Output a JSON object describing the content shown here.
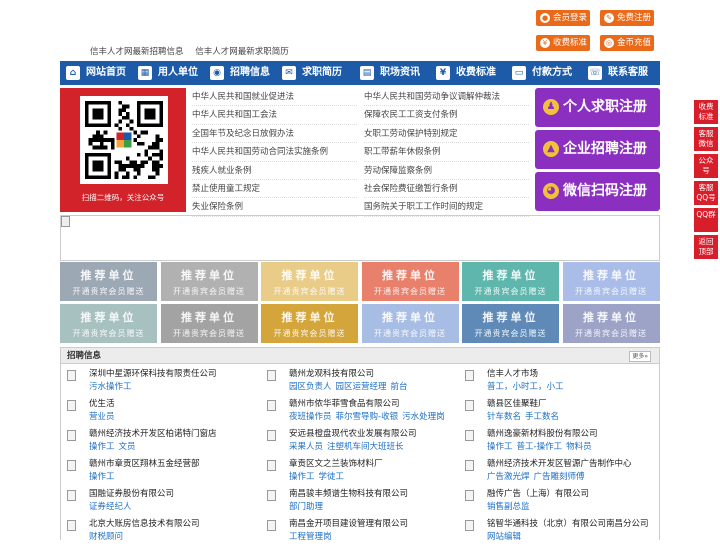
{
  "header": {
    "buttons": [
      {
        "label": "会员登录",
        "icon": "user-icon"
      },
      {
        "label": "免费注册",
        "icon": "register-icon"
      },
      {
        "label": "收费标准",
        "icon": "price-icon"
      },
      {
        "label": "金币充值",
        "icon": "coin-icon"
      }
    ],
    "links": [
      "信丰人才网最新招聘信息",
      "信丰人才网最新求职简历"
    ]
  },
  "nav": {
    "color": "#1d5ba8",
    "items": [
      {
        "label": "网站首页",
        "icon": "home-icon"
      },
      {
        "label": "用人单位",
        "icon": "building-icon"
      },
      {
        "label": "招聘信息",
        "icon": "broadcast-icon"
      },
      {
        "label": "求职简历",
        "icon": "resume-icon"
      },
      {
        "label": "职场资讯",
        "icon": "news-icon"
      },
      {
        "label": "收费标准",
        "icon": "price-icon"
      },
      {
        "label": "付款方式",
        "icon": "payment-icon"
      },
      {
        "label": "联系客服",
        "icon": "phone-icon"
      }
    ]
  },
  "qr": {
    "caption": "扫描二维码，关注公众号"
  },
  "laws": {
    "left": [
      "中华人民共和国就业促进法",
      "中华人民共和国工会法",
      "全国年节及纪念日放假办法",
      "中华人民共和国劳动合同法实施条例",
      "残疾人就业条例",
      "禁止使用童工规定",
      "失业保险条例"
    ],
    "right": [
      "中华人民共和国劳动争议调解仲裁法",
      "保障农民工工资支付条例",
      "女职工劳动保护特别规定",
      "职工带薪年休假条例",
      "劳动保障监察条例",
      "社会保险费征缴暂行条例",
      "国务院关于职工工作时间的规定"
    ]
  },
  "register": [
    {
      "label": "个人求职注册",
      "icon": "person-icon"
    },
    {
      "label": "企业招聘注册",
      "icon": "company-icon"
    },
    {
      "label": "微信扫码注册",
      "icon": "wechat-icon"
    }
  ],
  "sidebar": [
    "收费标准",
    "客服微信",
    "公众号",
    "客服QQ号",
    "QQ群",
    "返回顶部"
  ],
  "recommend": {
    "title": "推荐单位",
    "subtitle": "开通贵宾会员赠送",
    "colors": [
      "#9da8b5",
      "#b1b1b1",
      "#e9cc88",
      "#e8806b",
      "#5fb6ad",
      "#a9bde8",
      "#a7c0c0",
      "#a3a3a3",
      "#d4a53a",
      "#a8bde4",
      "#5f8ab8",
      "#9ca3c7"
    ]
  },
  "jobs": {
    "title": "招聘信息",
    "more": "更多»",
    "rows": [
      [
        {
          "company": "深圳中星源环保科技有限责任公司",
          "positions": [
            "污水操作工"
          ]
        },
        {
          "company": "赣州龙观科技有限公司",
          "positions": [
            "园区负责人",
            "园区运营经理",
            "前台"
          ]
        },
        {
          "company": "信丰人才市场",
          "positions": [
            "普工，小时工，小工"
          ]
        }
      ],
      [
        {
          "company": "优生活",
          "positions": [
            "营业员"
          ]
        },
        {
          "company": "赣州市侬华菲雪食品有限公司",
          "positions": [
            "夜班操作员",
            "菲尔雪导购-收银",
            "污水处理岗"
          ]
        },
        {
          "company": "赣县区佳聚鞋厂",
          "positions": [
            "针车数名",
            "手工数名"
          ]
        }
      ],
      [
        {
          "company": "赣州经济技术开发区柏诺特门窗店",
          "positions": [
            "操作工",
            "文员"
          ]
        },
        {
          "company": "安远县橙盘现代农业发展有限公司",
          "positions": [
            "采果人员",
            "注塑机车间大班班长"
          ]
        },
        {
          "company": "赣州逸豪新材料股份有限公司",
          "positions": [
            "操作工",
            "普工-操作工",
            "物料员"
          ]
        }
      ],
      [
        {
          "company": "赣州市章贡区翔林五金经营部",
          "positions": [
            "操作工"
          ]
        },
        {
          "company": "章贡区文之兰装饰材料厂",
          "positions": [
            "操作工",
            "学徒工"
          ]
        },
        {
          "company": "赣州经济技术开发区智源广告制作中心",
          "positions": [
            "广告激光焊",
            "广告雕刻师傅"
          ]
        }
      ],
      [
        {
          "company": "国融证券股份有限公司",
          "positions": [
            "证券经纪人"
          ]
        },
        {
          "company": "南昌骏丰频谱生物科技有限公司",
          "positions": [
            "部门助理"
          ]
        },
        {
          "company": "融传广告（上海）有限公司",
          "positions": [
            "销售副总监"
          ]
        }
      ],
      [
        {
          "company": "北京大账房信息技术有限公司",
          "positions": [
            "财税顾问"
          ]
        },
        {
          "company": "南昌金开项目建设管理有限公司",
          "positions": [
            "工程管理岗"
          ]
        },
        {
          "company": "铭智华通科技（北京）有限公司南昌分公司",
          "positions": [
            "网站编辑"
          ]
        }
      ]
    ]
  }
}
